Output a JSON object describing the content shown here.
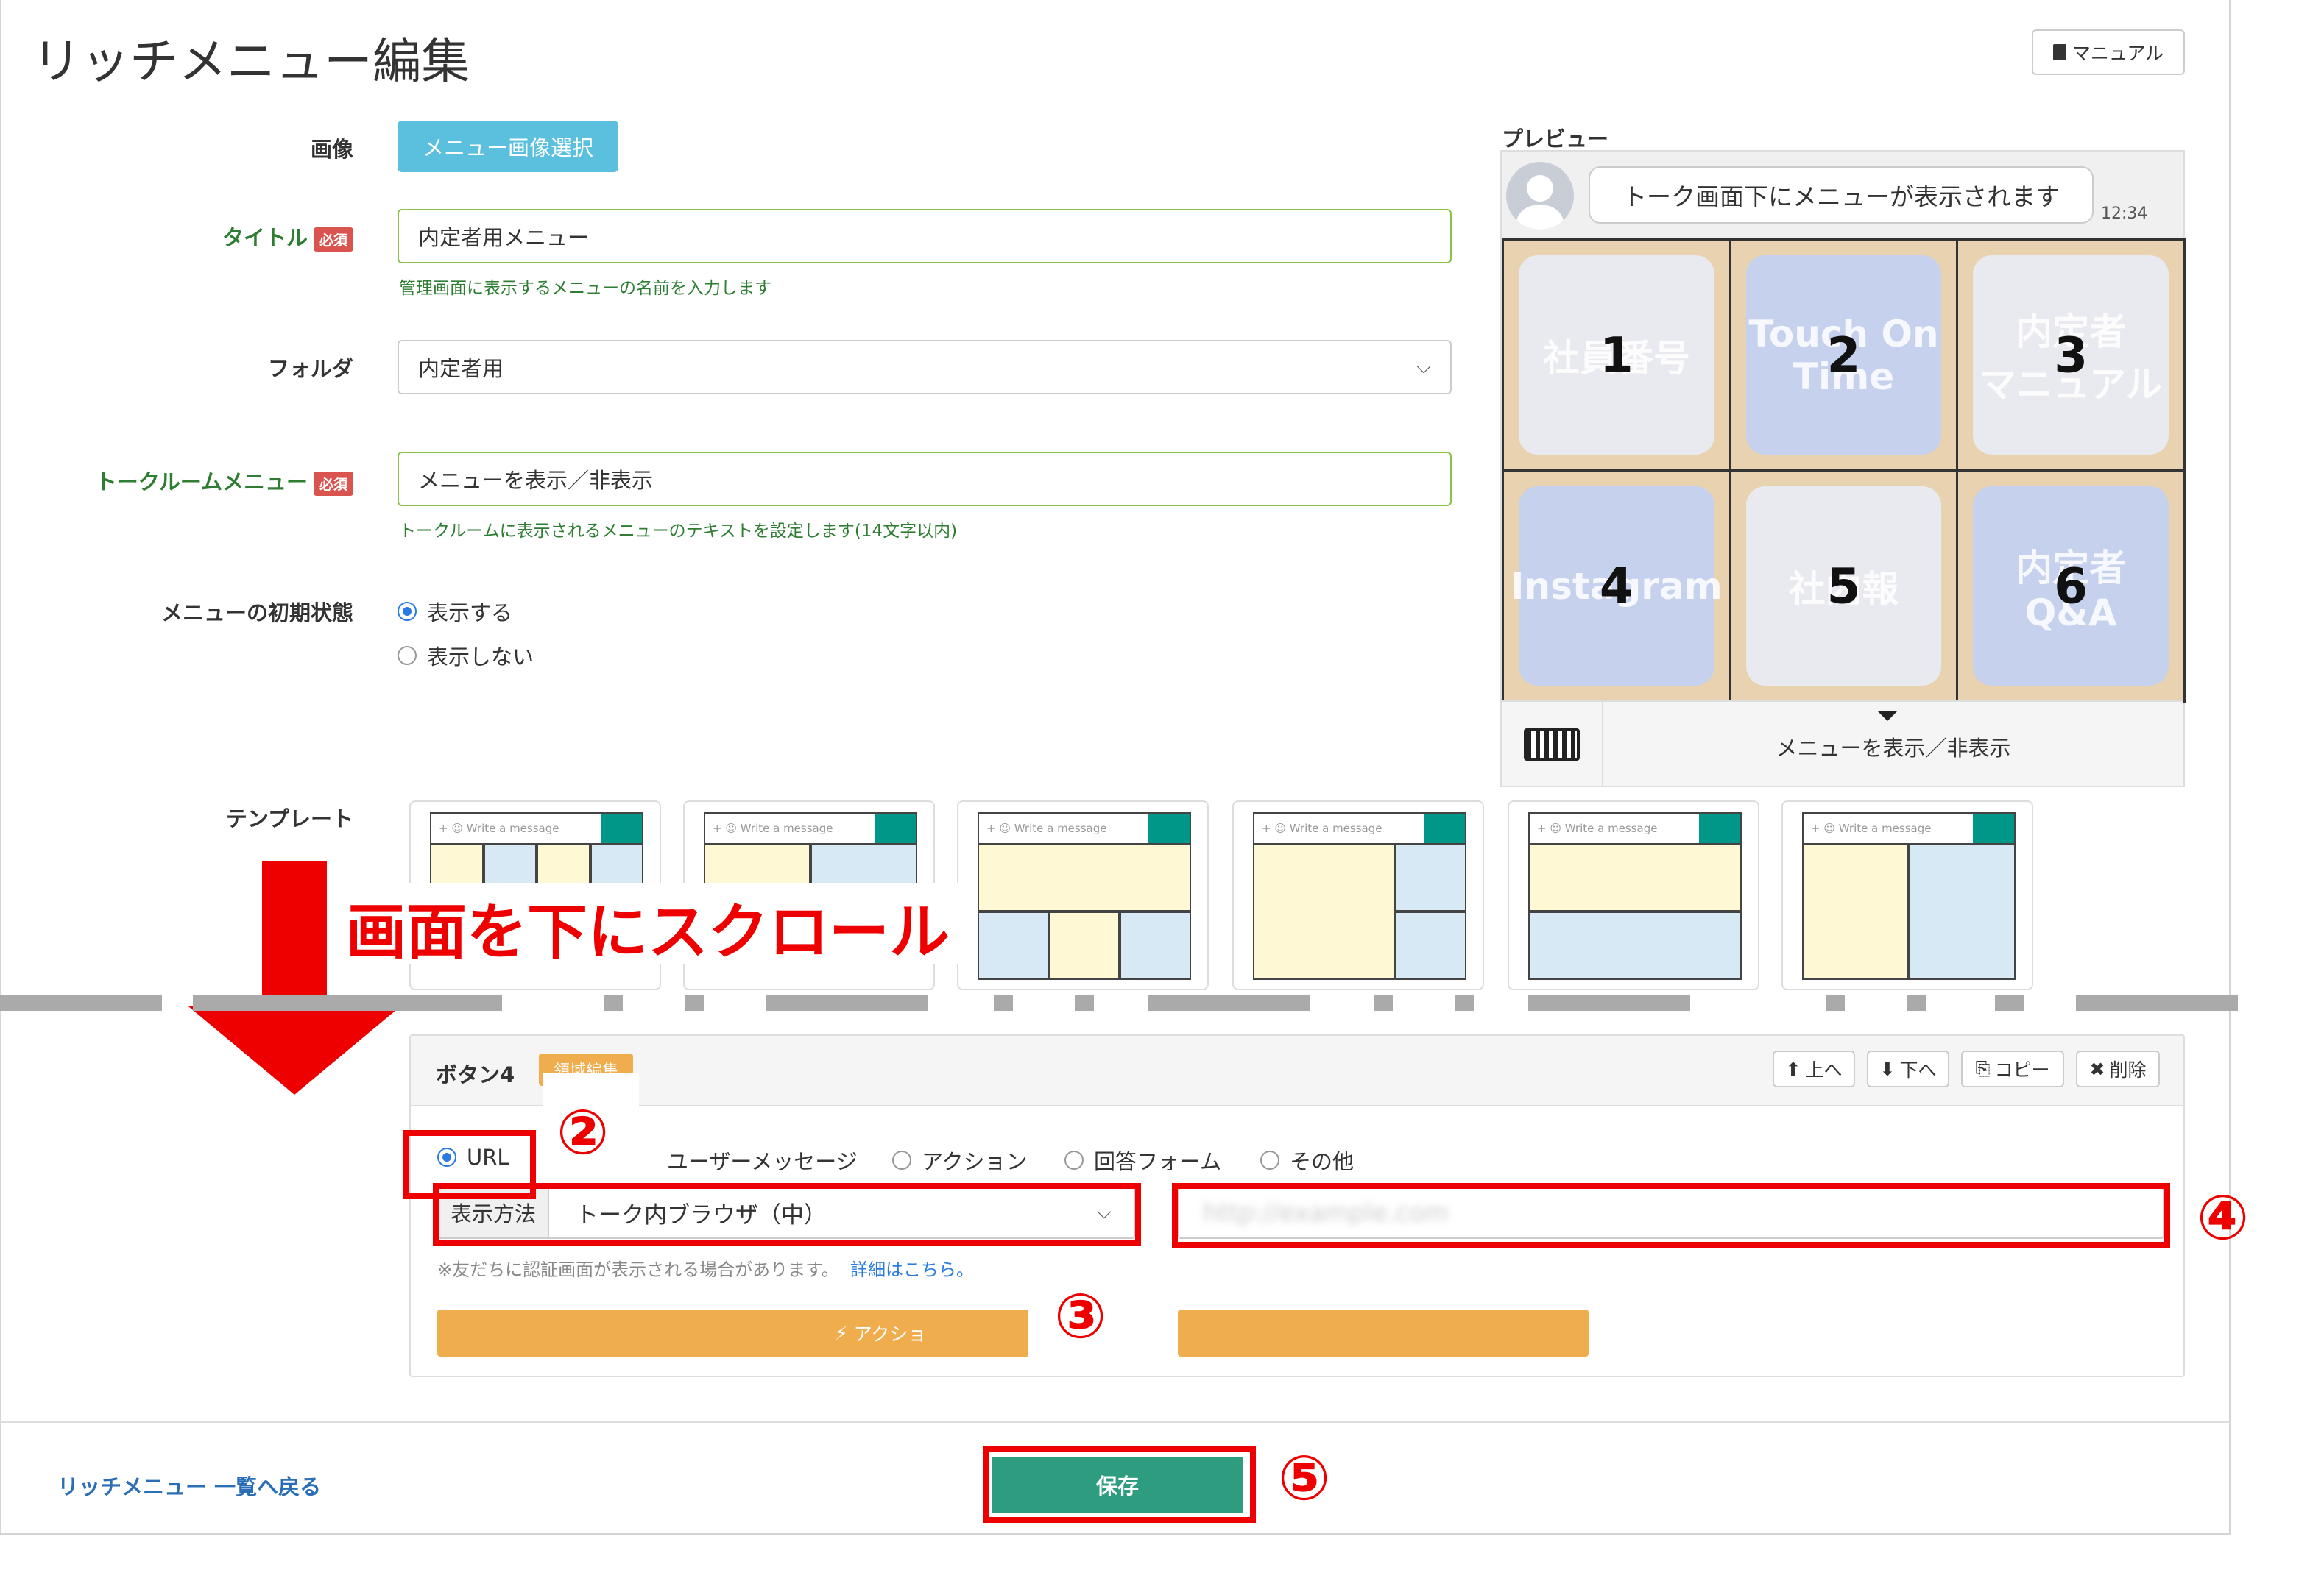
{
  "page": {
    "title": "リッチメニュー編集",
    "manual_label": "マニュアル"
  },
  "form": {
    "image_label": "画像",
    "select_image_button": "メニュー画像選択",
    "title_label": "タイトル",
    "required_badge": "必須",
    "title_value": "内定者用メニュー",
    "title_hint": "管理画面に表示するメニューの名前を入力します",
    "folder_label": "フォルダ",
    "folder_value": "内定者用",
    "talkroom_label": "トークルームメニュー",
    "talkroom_value": "メニューを表示／非表示",
    "talkroom_hint": "トークルームに表示されるメニューのテキストを設定します(14文字以内)",
    "initial_state_label": "メニューの初期状態",
    "show_option": "表示する",
    "hide_option": "表示しない",
    "template_label": "テンプレート"
  },
  "preview": {
    "label": "プレビュー",
    "bubble_text": "トーク画面下にメニューが表示されます",
    "time": "12:34",
    "tiles": [
      {
        "text": "社員番号",
        "num": "1",
        "color": "#e9eaf0"
      },
      {
        "text": "Touch On Time",
        "num": "2",
        "color": "#c6d1ee"
      },
      {
        "text": "内定者\nマニュアル",
        "num": "3",
        "color": "#e9eaf0"
      },
      {
        "text": "Instagram",
        "num": "4",
        "color": "#c6d1ee"
      },
      {
        "text": "社内報",
        "num": "5",
        "color": "#e9eaf0"
      },
      {
        "text": "内定者\nQ&A",
        "num": "6",
        "color": "#c6d1ee"
      }
    ],
    "footer_text": "メニューを表示／非表示"
  },
  "template_bar_text": "Write a message",
  "annotation": {
    "scroll_text": "画面を下にスクロール",
    "c2": "②",
    "c3": "③",
    "c4": "④",
    "c5": "⑤"
  },
  "button_panel": {
    "title": "ボタン4",
    "area_badge": "領域編集",
    "up": "上へ",
    "down": "下へ",
    "copy": "コピー",
    "delete": "削除",
    "types": [
      "URL",
      "ユーザーメッセージ",
      "アクション",
      "回答フォーム",
      "その他"
    ],
    "display_method_label": "表示方法",
    "display_method_value": "トーク内ブラウザ（中）",
    "url_placeholder": "http://example.com",
    "note": "※友だちに認証画面が表示される場合があります。",
    "note_link": "詳細はこちら。",
    "action_button": "アクショ"
  },
  "footer": {
    "back_link": "リッチメニュー 一覧へ戻る",
    "save": "保存"
  }
}
